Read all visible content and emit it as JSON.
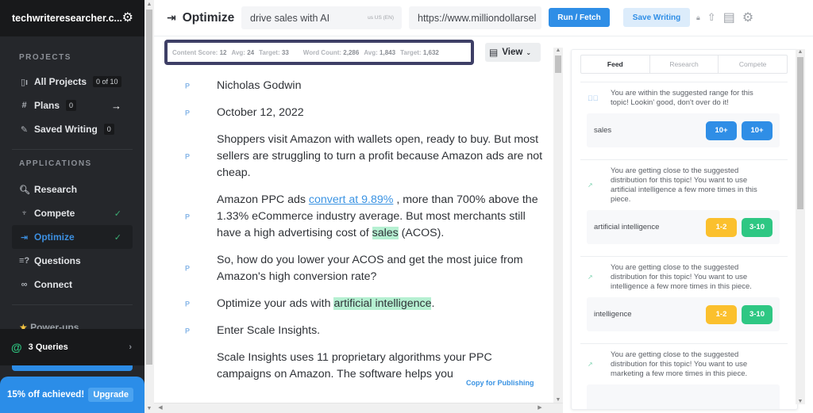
{
  "sidebar": {
    "org_name": "techwriteresearcher.c...",
    "projects_heading": "PROJECTS",
    "projects": [
      {
        "label": "All Projects",
        "count": "0 of 10",
        "icon": "projects-icon"
      },
      {
        "label": "Plans",
        "count": "0",
        "icon": "hash-icon"
      },
      {
        "label": "Saved Writing",
        "count": "0",
        "icon": "edit-icon"
      }
    ],
    "applications_heading": "APPLICATIONS",
    "applications": [
      {
        "label": "Research",
        "icon": "search-icon",
        "checked": false
      },
      {
        "label": "Compete",
        "icon": "trophy-icon",
        "checked": true
      },
      {
        "label": "Optimize",
        "icon": "optimize-icon",
        "checked": true,
        "active": true
      },
      {
        "label": "Questions",
        "icon": "questions-icon",
        "checked": false
      },
      {
        "label": "Connect",
        "icon": "link-icon",
        "checked": false
      }
    ],
    "powerups_label": "Power-ups",
    "queries_label": "3 Queries",
    "promo_text": "15% off achieved!",
    "upgrade_label": "Upgrade",
    "accent_color": "#2b8de8"
  },
  "topbar": {
    "title": "Optimize",
    "keyword": "drive sales with AI",
    "locale": "us  US (EN)",
    "url": "https://www.milliondollarsel",
    "run_label": "Run / Fetch",
    "save_label": "Save Writing"
  },
  "metrics": {
    "content_score_label": "Content Score:",
    "content_score": "12",
    "content_avg_label": "Avg:",
    "content_avg": "24",
    "content_target_label": "Target:",
    "content_target": "33",
    "word_count_label": "Word Count:",
    "word_count": "2,286",
    "word_avg_label": "Avg:",
    "word_avg": "1,843",
    "word_target_label": "Target:",
    "word_target": "1,632"
  },
  "view_label": "View",
  "editor": {
    "tag": "P",
    "paragraphs": [
      {
        "text": "Nicholas Godwin"
      },
      {
        "text": "October 12, 2022"
      },
      {
        "text": "Shoppers visit Amazon with wallets open, ready to buy. But most sellers are struggling to turn a profit because Amazon ads are not cheap."
      },
      {
        "pre": "Amazon PPC ads ",
        "link": "convert at 9.89%",
        "mid": " , more than 700% above the 1.33% eCommerce industry average. But most merchants still have a high advertising cost of ",
        "highlight": "sales",
        "post": " (ACOS)."
      },
      {
        "text": "So, how do you lower your ACOS and get the most juice from Amazon's high conversion rate?"
      },
      {
        "pre": "Optimize your ads with ",
        "highlight": "artificial intelligence",
        "post": "."
      },
      {
        "text": "Enter Scale Insights."
      },
      {
        "text": "Scale Insights uses 11 proprietary algorithms your PPC campaigns on Amazon. The software helps you"
      }
    ],
    "copy_label": "Copy for Publishing"
  },
  "panel": {
    "tabs": [
      "Feed",
      "Research",
      "Compete"
    ],
    "active_tab": "Feed",
    "feed": [
      {
        "icon": "check-circle-icon",
        "message": "You are within the suggested range for this topic! Lookin' good, don't over do it!",
        "keyword": "sales",
        "badges": [
          {
            "text": "10+",
            "color": "blue"
          },
          {
            "text": "10+",
            "color": "blue"
          }
        ]
      },
      {
        "icon": "trend-up-icon",
        "message": "You are getting close to the suggested distribution for this topic! You want to use artificial intelligence a few more times in this piece.",
        "keyword": "artificial intelligence",
        "badges": [
          {
            "text": "1-2",
            "color": "yellow"
          },
          {
            "text": "3-10",
            "color": "green"
          }
        ]
      },
      {
        "icon": "trend-up-icon",
        "message": "You are getting close to the suggested distribution for this topic! You want to use intelligence a few more times in this piece.",
        "keyword": "intelligence",
        "badges": [
          {
            "text": "1-2",
            "color": "yellow"
          },
          {
            "text": "3-10",
            "color": "green"
          }
        ]
      },
      {
        "icon": "trend-up-icon",
        "message": "You are getting close to the suggested distribution for this topic! You want to use marketing a few more times in this piece.",
        "keyword": "",
        "badges": []
      }
    ]
  }
}
